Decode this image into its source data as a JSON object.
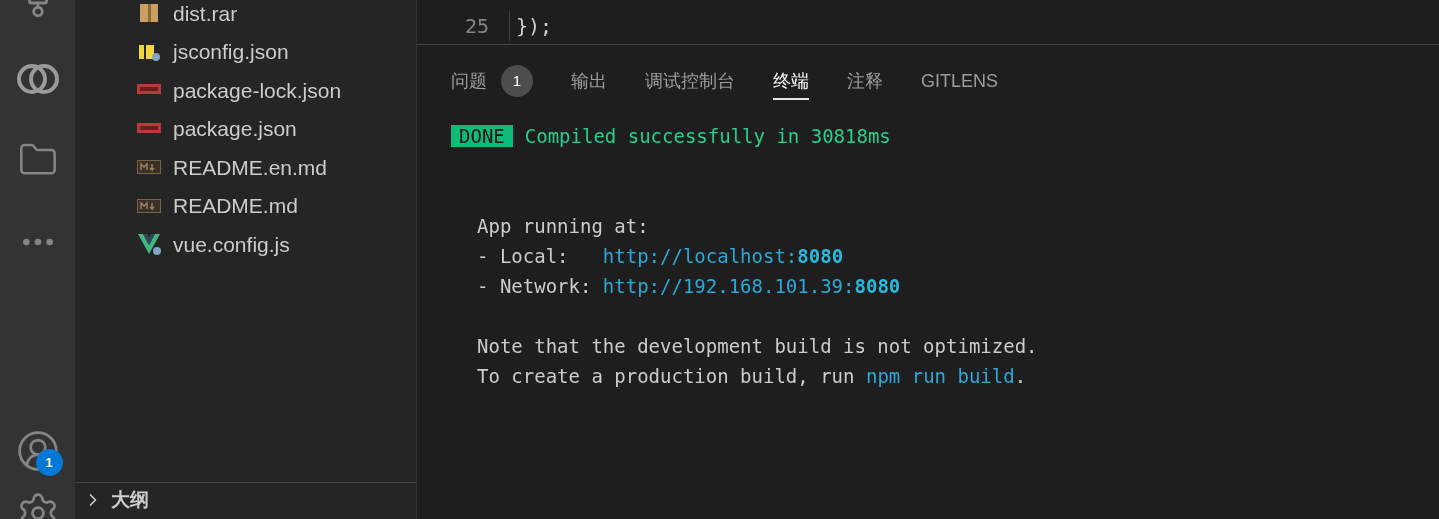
{
  "explorer": {
    "files": [
      {
        "name": "dist.rar",
        "kind": "archive"
      },
      {
        "name": "jsconfig.json",
        "kind": "jsconfig"
      },
      {
        "name": "package-lock.json",
        "kind": "npm"
      },
      {
        "name": "package.json",
        "kind": "npm"
      },
      {
        "name": "README.en.md",
        "kind": "markdown"
      },
      {
        "name": "README.md",
        "kind": "markdown"
      },
      {
        "name": "vue.config.js",
        "kind": "vue"
      }
    ],
    "outline": {
      "label": "大纲",
      "expanded": false
    }
  },
  "activity_bar": {
    "account_badge": "1"
  },
  "editor": {
    "lines": [
      {
        "number": "25",
        "code": "});"
      }
    ]
  },
  "panel": {
    "tabs": [
      {
        "label": "问题",
        "badge": "1",
        "selected": false
      },
      {
        "label": "输出",
        "selected": false
      },
      {
        "label": "调试控制台",
        "selected": false
      },
      {
        "label": "终端",
        "selected": true
      },
      {
        "label": "注释",
        "selected": false
      },
      {
        "label": "GITLENS",
        "selected": false
      }
    ],
    "terminal_blocks": [
      {
        "lines": [
          {
            "segments": [
              {
                "kind": "done",
                "text": "DONE"
              },
              {
                "kind": "success",
                "text": "Compiled successfully in 30818ms"
              }
            ]
          }
        ]
      },
      {
        "lines": [
          {
            "segments": [
              {
                "kind": "plain",
                "text": "App running at:"
              }
            ]
          },
          {
            "segments": [
              {
                "kind": "plain",
                "text": "- Local:   "
              },
              {
                "kind": "link",
                "text": "http://localhost:"
              },
              {
                "kind": "link_bold",
                "text": "8080"
              }
            ]
          },
          {
            "segments": [
              {
                "kind": "plain",
                "text": "- Network: "
              },
              {
                "kind": "link",
                "text": "http://192.168.101.39:"
              },
              {
                "kind": "link_bold",
                "text": "8080"
              }
            ]
          }
        ]
      },
      {
        "lines": [
          {
            "segments": [
              {
                "kind": "plain",
                "text": "Note that the development build is not optimized."
              }
            ]
          },
          {
            "segments": [
              {
                "kind": "plain",
                "text": "To create a production build, run "
              },
              {
                "kind": "link",
                "text": "npm run build"
              },
              {
                "kind": "plain",
                "text": "."
              }
            ]
          }
        ]
      }
    ]
  }
}
